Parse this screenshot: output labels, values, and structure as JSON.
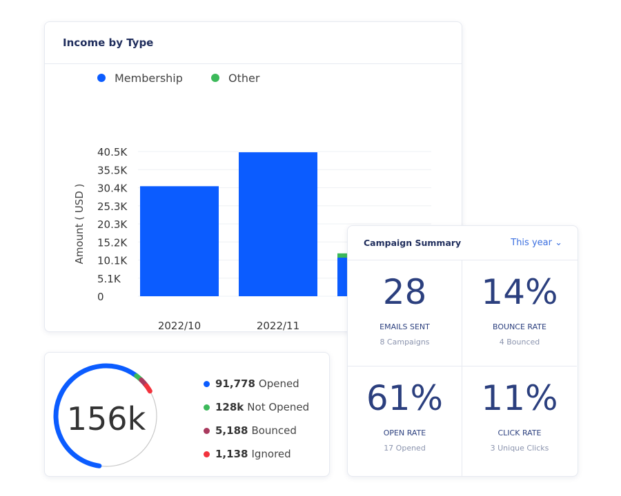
{
  "income": {
    "title": "Income by Type",
    "chart_data": {
      "type": "bar",
      "stacked": true,
      "categories": [
        "2022/10",
        "2022/11",
        ""
      ],
      "series": [
        {
          "name": "Membership",
          "color": "#0b5cff",
          "values": [
            30.8,
            40.3,
            10.8
          ]
        },
        {
          "name": "Other",
          "color": "#3cb95a",
          "values": [
            0,
            0,
            1.2
          ]
        }
      ],
      "ylabel": "Amount ( USD )",
      "yticks": [
        "0",
        "5.1K",
        "10.1K",
        "15.2K",
        "20.3K",
        "25.3K",
        "30.4K",
        "35.5K",
        "40.5K"
      ],
      "ylim": [
        0,
        40.5
      ],
      "grid": true,
      "legend": "top-left"
    }
  },
  "emails": {
    "total": "156k",
    "items": [
      {
        "value": "91,778",
        "label": "Opened",
        "color": "#0b5cff",
        "arc": 0.58
      },
      {
        "value": "128k",
        "label": "Not Opened",
        "color": "#3cb95a",
        "arc": 0.02
      },
      {
        "value": "5,188",
        "label": "Bounced",
        "color": "#a93a5e",
        "arc": 0.025
      },
      {
        "value": "1,138",
        "label": "Ignored",
        "color": "#f2333d",
        "arc": 0.02
      }
    ]
  },
  "campaign": {
    "title": "Campaign Summary",
    "period": "This year",
    "stats": [
      {
        "value": "28",
        "label": "EMAILS SENT",
        "sub": "8 Campaigns"
      },
      {
        "value": "14%",
        "label": "BOUNCE RATE",
        "sub": "4 Bounced"
      },
      {
        "value": "61%",
        "label": "OPEN RATE",
        "sub": "17 Opened"
      },
      {
        "value": "11%",
        "label": "CLICK RATE",
        "sub": "3 Unique Clicks"
      }
    ]
  }
}
